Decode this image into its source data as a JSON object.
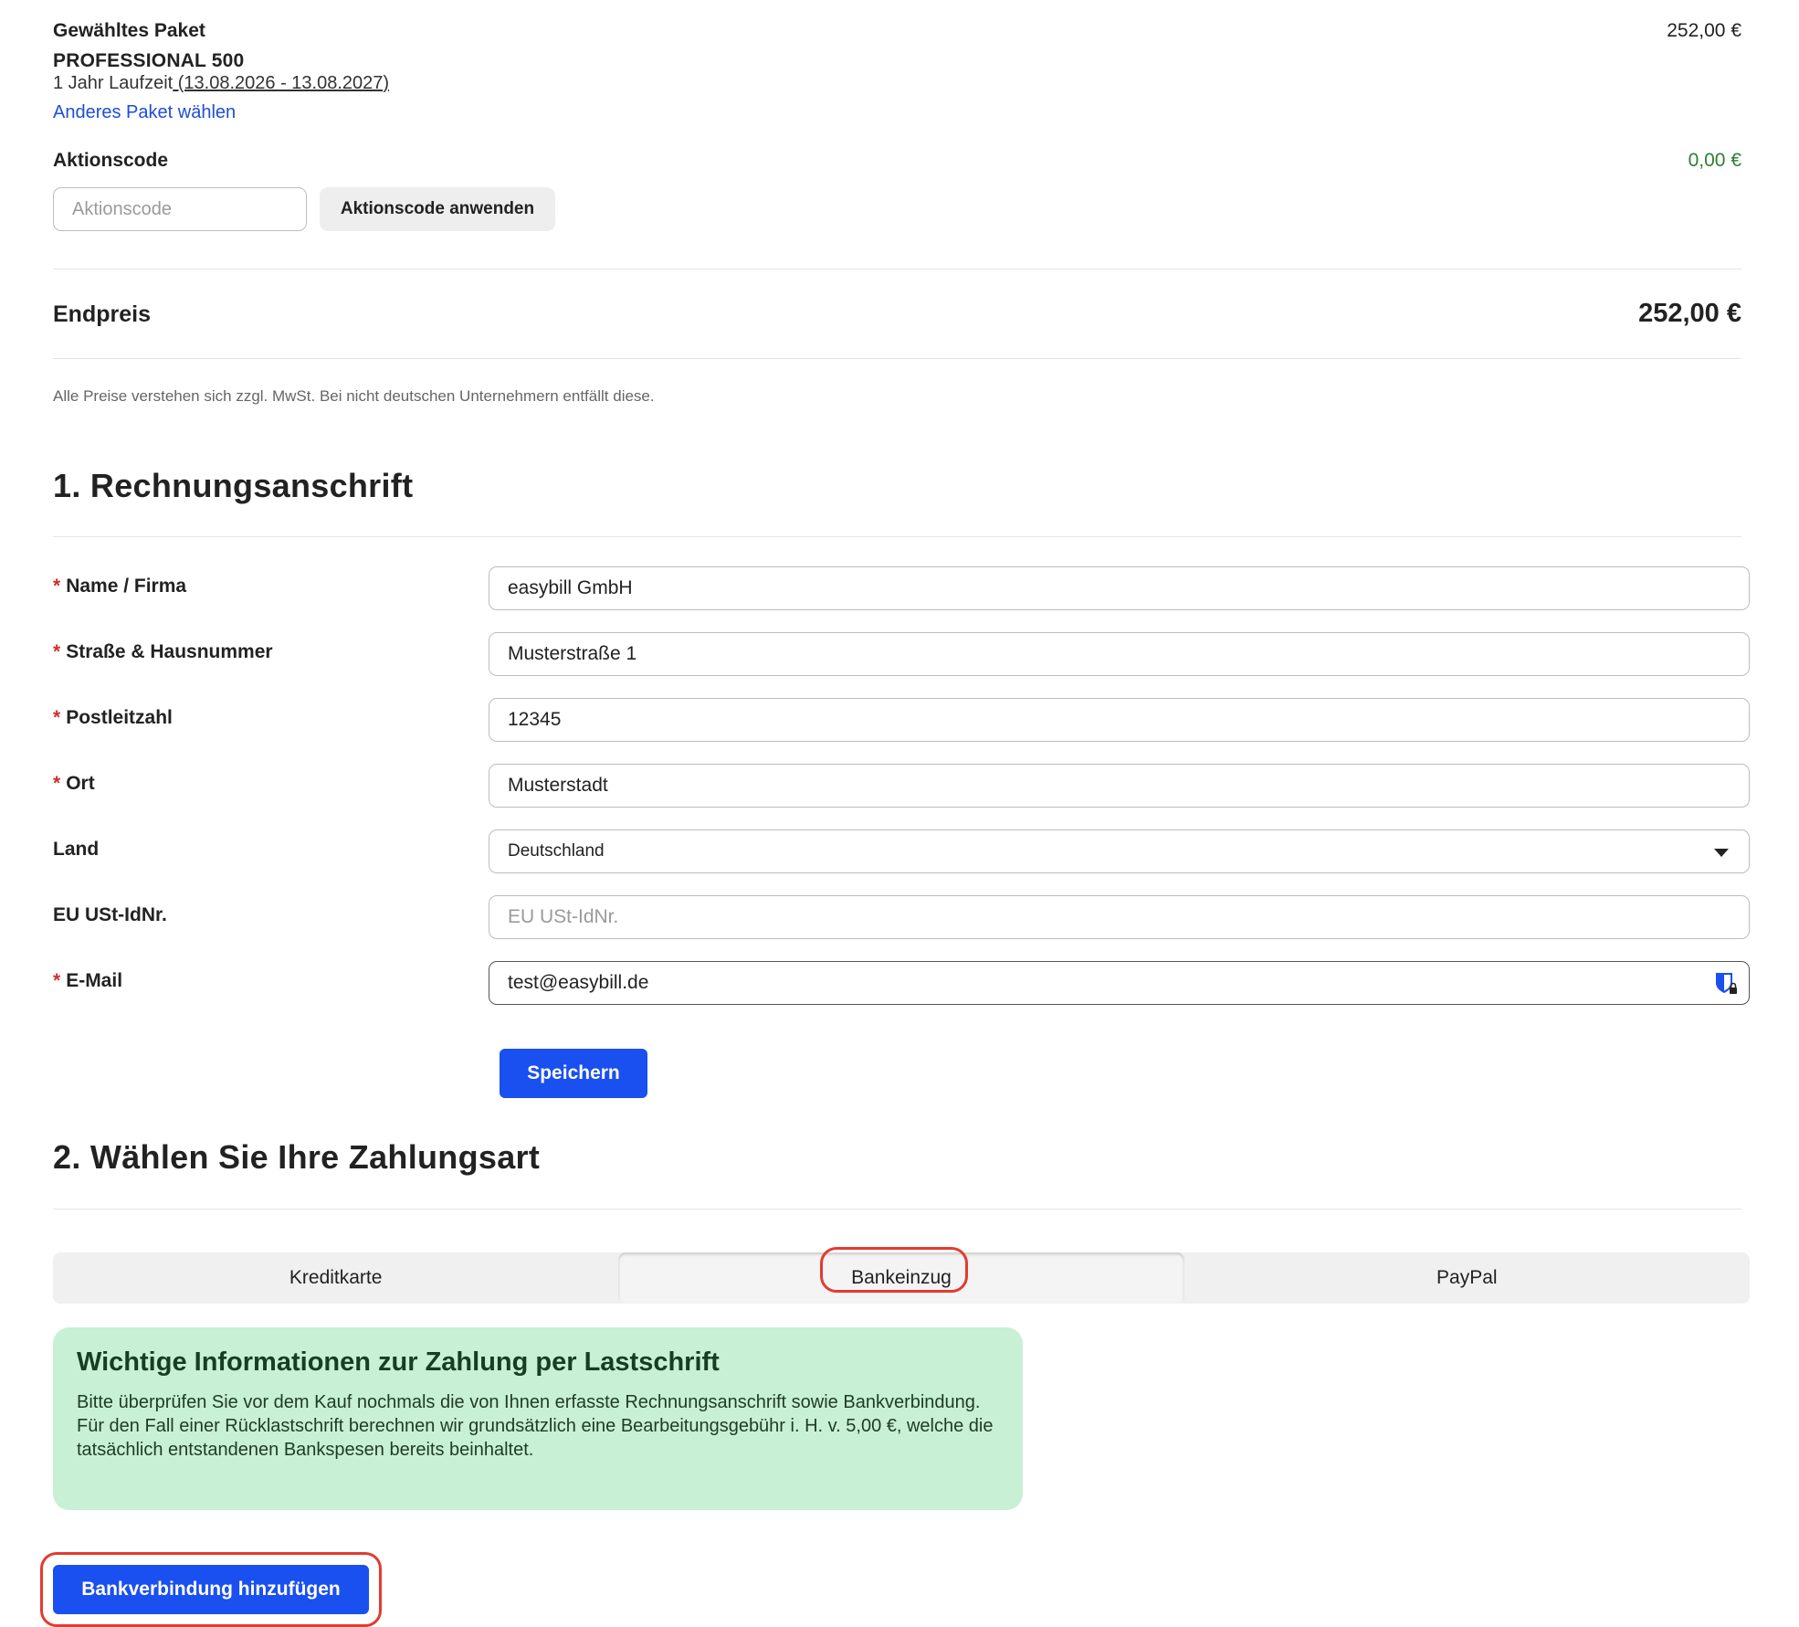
{
  "package": {
    "heading": "Gewähltes Paket",
    "name": "PROFESSIONAL 500",
    "term_prefix": "1 Jahr Laufzeit",
    "term_dates": " (13.08.2026 - 13.08.2027)",
    "change_link": "Anderes Paket wählen",
    "price": "252,00 €"
  },
  "promo": {
    "label": "Aktionscode",
    "placeholder": "Aktionscode",
    "apply_button": "Aktionscode anwenden",
    "discount": "0,00 €"
  },
  "total": {
    "label": "Endpreis",
    "value": "252,00 €",
    "vat_note": "Alle Preise verstehen sich zzgl. MwSt. Bei nicht deutschen Unternehmern entfällt diese."
  },
  "billing": {
    "title": "1. Rechnungsanschrift",
    "required_marker": "*",
    "fields": [
      {
        "label": "Name / Firma",
        "value": "easybill GmbH",
        "required": true
      },
      {
        "label": "Straße & Hausnummer",
        "value": "Musterstraße 1",
        "required": true
      },
      {
        "label": "Postleitzahl",
        "value": "12345",
        "required": true
      },
      {
        "label": "Ort",
        "value": "Musterstadt",
        "required": true
      },
      {
        "label": "Land",
        "value": "Deutschland",
        "required": false
      },
      {
        "label": "EU USt-IdNr.",
        "value": "",
        "placeholder": "EU USt-IdNr.",
        "required": false
      },
      {
        "label": "E-Mail",
        "value": "test@easybill.de",
        "required": true
      }
    ],
    "save_button": "Speichern"
  },
  "payment": {
    "title": "2. Wählen Sie Ihre Zahlungsart",
    "tabs": [
      {
        "label": "Kreditkarte",
        "active": false
      },
      {
        "label": "Bankeinzug",
        "active": true
      },
      {
        "label": "PayPal",
        "active": false
      }
    ],
    "info_title": "Wichtige Informationen zur Zahlung per Lastschrift",
    "info_body": "Bitte überprüfen Sie vor dem Kauf nochmals die von Ihnen erfasste Rechnungsanschrift sowie Bankverbindung. Für den Fall einer Rücklastschrift berechnen wir grundsätzlich eine Bearbeitungsgebühr i. H. v. 5,00 €, welche die tatsächlich entstandenen Bankspesen bereits beinhaltet.",
    "add_bank_button": "Bankverbindung hinzufügen"
  },
  "colors": {
    "accent": "#1a4ff0",
    "link": "#1d4ed8",
    "required": "#d32f2f",
    "discount": "#2e7d32",
    "info_background": "#c8f0d4",
    "highlight": "#e33b2e"
  },
  "icons": {
    "country_select": "chevron-down-icon",
    "email_field": "password-manager-icon"
  }
}
